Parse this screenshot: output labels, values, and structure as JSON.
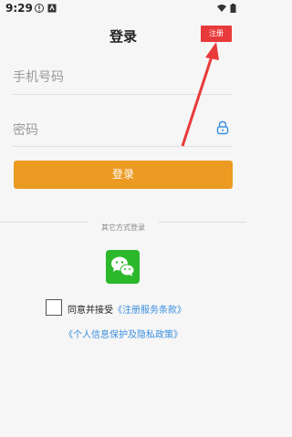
{
  "status_bar": {
    "time": "9:29",
    "icons": [
      "alert-icon",
      "app-icon",
      "wifi-icon",
      "battery-icon"
    ]
  },
  "header": {
    "title": "登录",
    "register_label": "注册"
  },
  "form": {
    "phone_placeholder": "手机号码",
    "password_placeholder": "密码",
    "login_label": "登录"
  },
  "other_login": {
    "label": "其它方式登录",
    "wechat_icon": "wechat-icon"
  },
  "agreement": {
    "prefix": "同意并接受",
    "terms_link": "《注册服务条款》",
    "privacy_link": "《个人信息保护及隐私政策》"
  },
  "colors": {
    "accent": "#eb9a22",
    "register_bg": "#e83a3a",
    "link": "#3a8fe0",
    "wechat": "#2bb82b"
  }
}
